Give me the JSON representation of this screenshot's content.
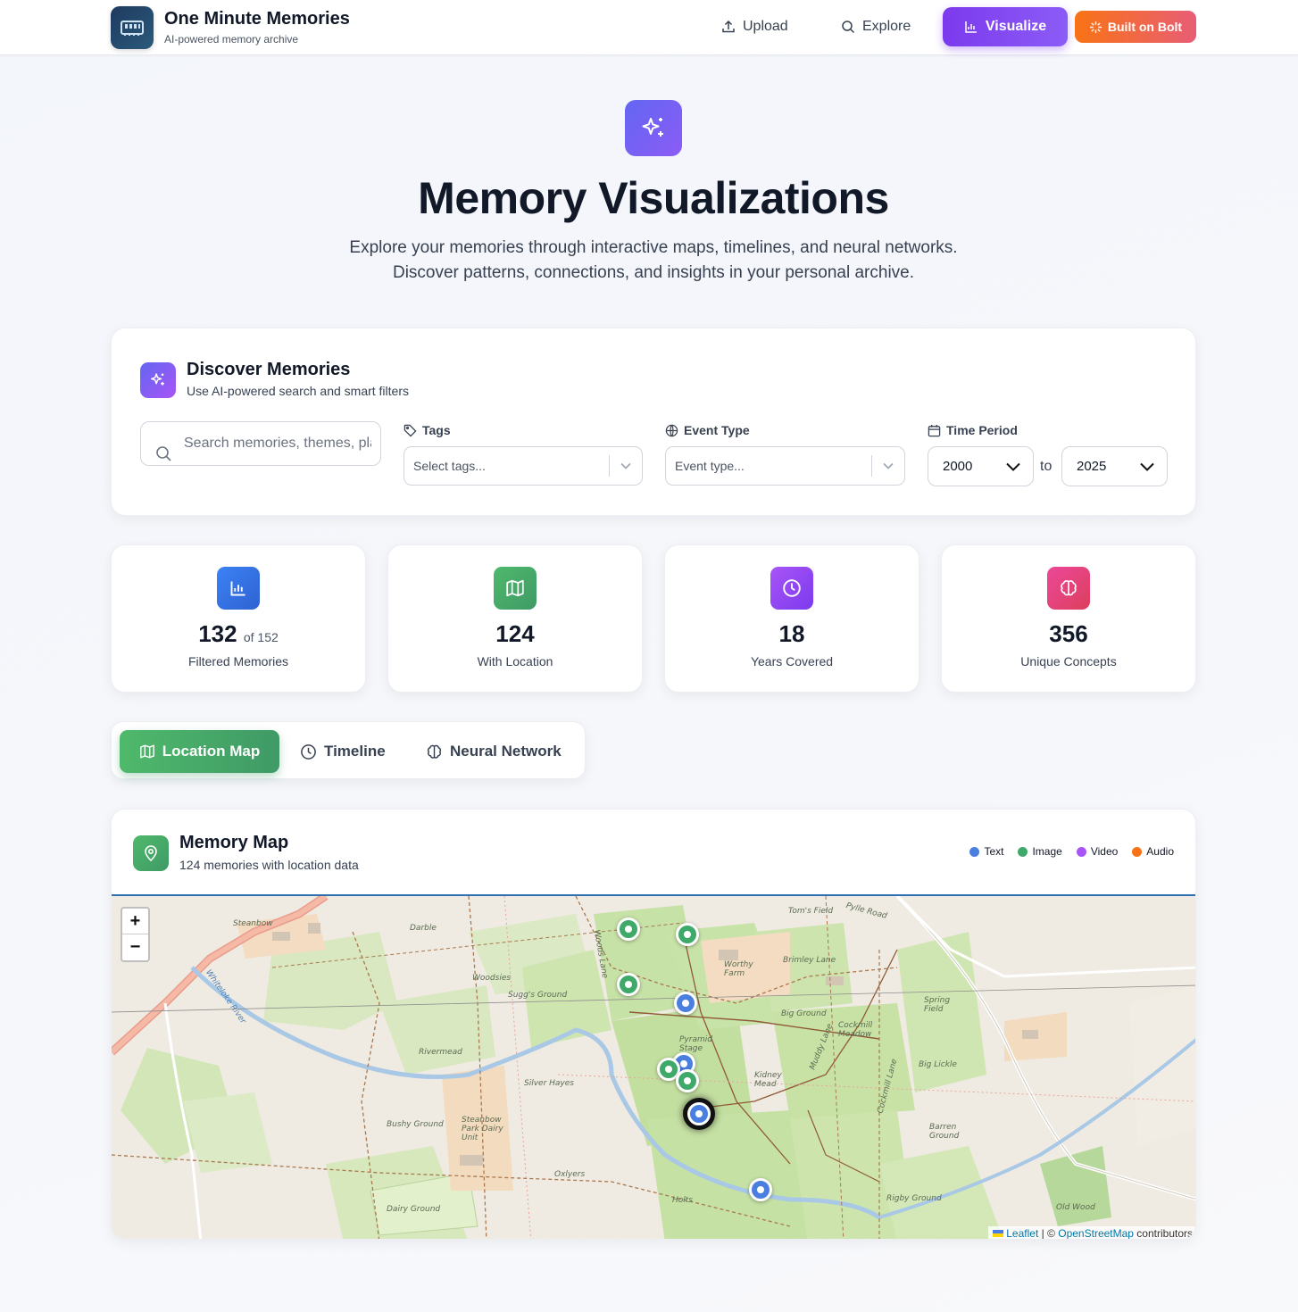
{
  "header": {
    "app_title": "One Minute Memories",
    "app_subtitle": "AI-powered memory archive",
    "nav": {
      "upload": "Upload",
      "explore": "Explore",
      "visualize": "Visualize",
      "bolt": "Built on Bolt"
    }
  },
  "hero": {
    "title": "Memory Visualizations",
    "description_line1": "Explore your memories through interactive maps, timelines, and neural networks.",
    "description_line2": "Discover patterns, connections, and insights in your personal archive."
  },
  "discover": {
    "title": "Discover Memories",
    "subtitle": "Use AI-powered search and smart filters",
    "search_placeholder": "Search memories, themes, places...",
    "tags_label": "Tags",
    "tags_placeholder": "Select tags...",
    "event_label": "Event Type",
    "event_placeholder": "Event type...",
    "time_label": "Time Period",
    "year_from": "2000",
    "to_label": "to",
    "year_to": "2025"
  },
  "stats": [
    {
      "value": "132",
      "of": "of 152",
      "label": "Filtered Memories",
      "color": "#3b73e0"
    },
    {
      "value": "124",
      "of": "",
      "label": "With Location",
      "color": "#43a565"
    },
    {
      "value": "18",
      "of": "",
      "label": "Years Covered",
      "color": "#8b5cf6"
    },
    {
      "value": "356",
      "of": "",
      "label": "Unique Concepts",
      "color": "#e04a6e"
    }
  ],
  "tabs": {
    "location": "Location Map",
    "timeline": "Timeline",
    "neural": "Neural Network"
  },
  "map": {
    "title": "Memory Map",
    "subtitle": "124 memories with location data",
    "legend": [
      {
        "label": "Text",
        "color": "#4a7fe0"
      },
      {
        "label": "Image",
        "color": "#3fa96a"
      },
      {
        "label": "Video",
        "color": "#a855f7"
      },
      {
        "label": "Audio",
        "color": "#f97316"
      }
    ],
    "zoom_in": "+",
    "zoom_out": "−",
    "attribution": {
      "leaflet": "Leaflet",
      "sep": " | © ",
      "osm": "OpenStreetMap",
      "contrib": " contributors"
    },
    "place_labels": [
      "Steanbow",
      "Darble",
      "Woodsies",
      "Sugg's Ground",
      "Whiteloke River",
      "Rivermead",
      "Silver Hayes",
      "Bushy Ground",
      "Steanbow Park Dairy Unit",
      "Oxlyers",
      "Dairy Ground",
      "Holts",
      "Pyramid Stage",
      "Kidney Mead",
      "Worthy Farm",
      "Tom's Field",
      "Pylle Road",
      "Brimley Lane",
      "Big Ground",
      "Cockmill Meadow",
      "Muddy Lane",
      "Cockmill Lane",
      "Spring Field",
      "Big Lickle",
      "Barren Ground",
      "Rigby Ground",
      "Old Wood",
      "Woods Lane"
    ]
  }
}
